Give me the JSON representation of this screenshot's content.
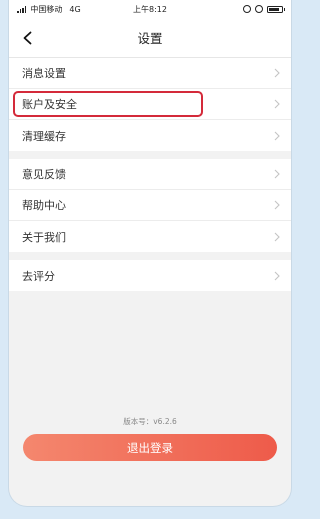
{
  "status_bar": {
    "carrier": "中国移动",
    "network": "4G",
    "time": "上午8:12"
  },
  "nav": {
    "title": "设置"
  },
  "groups": [
    {
      "items": [
        {
          "label": "消息设置"
        },
        {
          "label": "账户及安全",
          "highlighted": true
        },
        {
          "label": "清理缓存"
        }
      ]
    },
    {
      "items": [
        {
          "label": "意见反馈"
        },
        {
          "label": "帮助中心"
        },
        {
          "label": "关于我们"
        }
      ]
    },
    {
      "items": [
        {
          "label": "去评分"
        }
      ]
    }
  ],
  "version": "版本号：v6.2.6",
  "logout_label": "退出登录",
  "colors": {
    "highlight": "#d42a3a",
    "logout_start": "#f4876e",
    "logout_end": "#ee5b4a"
  }
}
